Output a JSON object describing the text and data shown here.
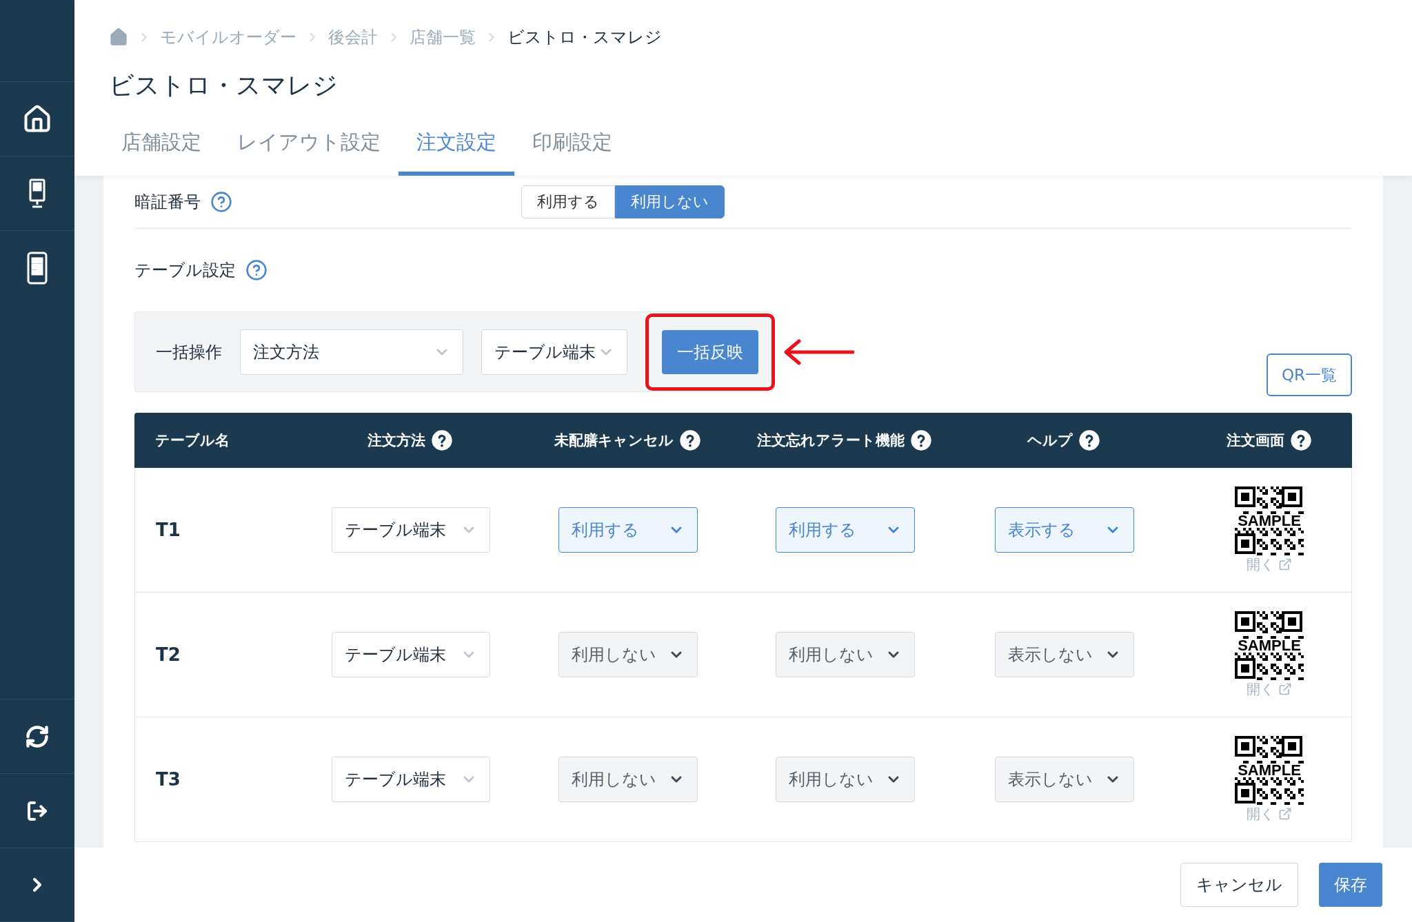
{
  "breadcrumbs": [
    "モバイルオーダー",
    "後会計",
    "店舗一覧",
    "ビストロ・スマレジ"
  ],
  "title": "ビストロ・スマレジ",
  "tabs": [
    {
      "label": "店舗設定",
      "selected": false
    },
    {
      "label": "レイアウト設定",
      "selected": false
    },
    {
      "label": "注文設定",
      "selected": true
    },
    {
      "label": "印刷設定",
      "selected": false
    }
  ],
  "pin_setting": {
    "label": "暗証番号",
    "options": [
      {
        "label": "利用する",
        "selected": false
      },
      {
        "label": "利用しない",
        "selected": true
      }
    ]
  },
  "table_settings": {
    "title": "テーブル設定",
    "bulk": {
      "label": "一括操作",
      "field_1": "注文方法",
      "field_2": "テーブル端末",
      "apply_button": "一括反映"
    },
    "qr_list_button": "QR一覧",
    "columns": [
      {
        "label": "テーブル名",
        "help": false
      },
      {
        "label": "注文方法",
        "help": true
      },
      {
        "label": "未配膳キャンセル",
        "help": true
      },
      {
        "label": "注文忘れアラート機能",
        "help": true
      },
      {
        "label": "ヘルプ",
        "help": true
      },
      {
        "label": "注文画面",
        "help": true
      }
    ],
    "rows": [
      {
        "name": "T1",
        "order_method": "テーブル端末",
        "cancel": {
          "value": "利用する",
          "enabled": true
        },
        "alert": {
          "value": "利用する",
          "enabled": true
        },
        "help": {
          "value": "表示する",
          "enabled": true
        },
        "qr_text": "SAMPLE",
        "open_link": "開く"
      },
      {
        "name": "T2",
        "order_method": "テーブル端末",
        "cancel": {
          "value": "利用しない",
          "enabled": false
        },
        "alert": {
          "value": "利用しない",
          "enabled": false
        },
        "help": {
          "value": "表示しない",
          "enabled": false
        },
        "qr_text": "SAMPLE",
        "open_link": "開く"
      },
      {
        "name": "T3",
        "order_method": "テーブル端末",
        "cancel": {
          "value": "利用しない",
          "enabled": false
        },
        "alert": {
          "value": "利用しない",
          "enabled": false
        },
        "help": {
          "value": "表示しない",
          "enabled": false
        },
        "qr_text": "SAMPLE",
        "open_link": "開く"
      }
    ]
  },
  "footer": {
    "cancel_button": "キャンセル",
    "save_button": "保存"
  }
}
